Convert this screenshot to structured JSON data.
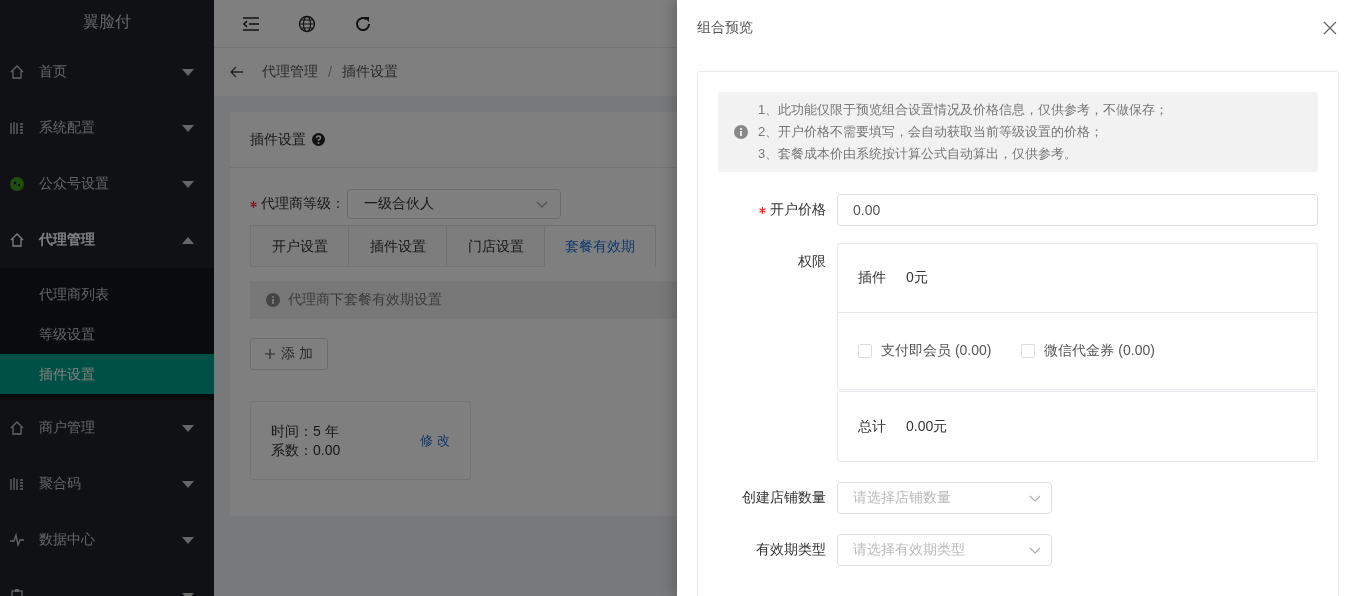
{
  "sidebar": {
    "logo": "翼脸付",
    "items": [
      {
        "label": "首页",
        "kind": "home",
        "expanded": false
      },
      {
        "label": "系统配置",
        "kind": "grid",
        "expanded": false
      },
      {
        "label": "公众号设置",
        "kind": "wechat",
        "expanded": false
      },
      {
        "label": "代理管理",
        "kind": "home",
        "expanded": true,
        "children": [
          {
            "label": "代理商列表",
            "selected": false
          },
          {
            "label": "等级设置",
            "selected": false
          },
          {
            "label": "插件设置",
            "selected": true
          }
        ]
      },
      {
        "label": "商户管理",
        "kind": "home",
        "expanded": false
      },
      {
        "label": "聚合码",
        "kind": "grid",
        "expanded": false
      },
      {
        "label": "数据中心",
        "kind": "pulse",
        "expanded": false
      },
      {
        "kind": "clipboard",
        "expanded": false
      }
    ]
  },
  "breadcrumb": {
    "separator": "/",
    "items": [
      "代理管理",
      "插件设置"
    ]
  },
  "card": {
    "title": "插件设置",
    "level_field": {
      "label": "代理商等级：",
      "required": true,
      "value": "一级合伙人"
    },
    "tabs": [
      {
        "label": "开户设置",
        "selected": false
      },
      {
        "label": "插件设置",
        "selected": false
      },
      {
        "label": "门店设置",
        "selected": false
      },
      {
        "label": "套餐有效期",
        "selected": true
      }
    ],
    "alert": "代理商下套餐有效期设置",
    "add_button": "添 加",
    "periods": [
      {
        "lines": [
          "时间：5 年",
          "系数：0.00"
        ],
        "edit": "修 改"
      }
    ]
  },
  "drawer": {
    "title": "组合预览",
    "notes": [
      "1、此功能仅限于预览组合设置情况及价格信息，仅供参考，不做保存；",
      "2、开户价格不需要填写，会自动获取当前等级设置的价格；",
      "3、套餐成本价由系统按计算公式自动算出，仅供参考。"
    ],
    "price": {
      "label": "开户价格",
      "required": true,
      "value": "0.00"
    },
    "permission": {
      "label": "权限",
      "plugin_label": "插件",
      "plugin_amount": "0元",
      "options": [
        {
          "label": "支付即会员 (0.00)",
          "checked": false
        },
        {
          "label": "微信代金券 (0.00)",
          "checked": false
        }
      ],
      "total_label": "总计",
      "total_value": "0.00元"
    },
    "selects": [
      {
        "label": "创建店铺数量",
        "placeholder": "请选择店铺数量"
      },
      {
        "label": "有效期类型",
        "placeholder": "请选择有效期类型"
      }
    ]
  }
}
